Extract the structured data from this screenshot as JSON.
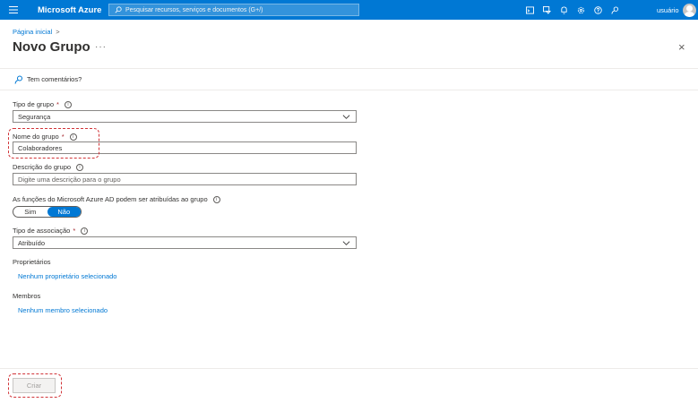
{
  "topbar": {
    "brand": "Microsoft Azure",
    "search_placeholder": "Pesquisar recursos, serviços e documentos (G+/)",
    "user": "usuário",
    "icons": [
      "cloud-shell-icon",
      "directory-filter-icon",
      "bell-icon",
      "gear-icon",
      "help-icon",
      "feedback-icon"
    ]
  },
  "breadcrumb": {
    "home": "Página inicial",
    "separator": ">"
  },
  "page": {
    "title": "Novo Grupo",
    "more": "···",
    "close": "×"
  },
  "feedback": {
    "label": "Tem comentários?"
  },
  "form": {
    "group_type": {
      "label": "Tipo de grupo",
      "required_mark": "*",
      "value": "Segurança"
    },
    "group_name": {
      "label": "Nome do grupo",
      "required_mark": "*",
      "value": "Colaboradores"
    },
    "group_description": {
      "label": "Descrição do grupo",
      "placeholder": "Digite uma descrição para o grupo"
    },
    "roles_assignable": {
      "label": "As funções do Microsoft Azure AD podem ser atribuídas ao grupo",
      "option_yes": "Sim",
      "option_no": "Não",
      "selected": "Não"
    },
    "membership_type": {
      "label": "Tipo de associação",
      "required_mark": "*",
      "value": "Atribuído"
    },
    "owners": {
      "label": "Proprietários",
      "link": "Nenhum proprietário selecionado"
    },
    "members": {
      "label": "Membros",
      "link": "Nenhum membro selecionado"
    }
  },
  "footer": {
    "create_label": "Criar"
  },
  "colors": {
    "accent": "#0078d4",
    "highlight": "#d13438"
  }
}
